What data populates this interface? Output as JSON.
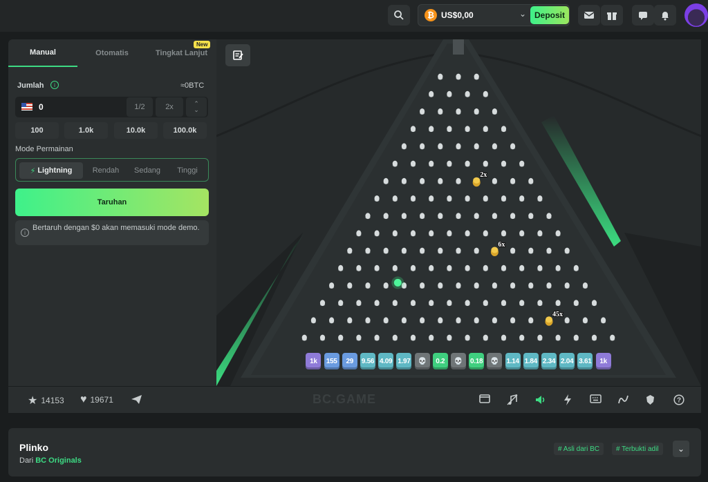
{
  "header": {
    "balance": "US$0,00",
    "deposit_label": "Deposit"
  },
  "panel": {
    "tabs": [
      "Manual",
      "Otomatis",
      "Tingkat Lanjut"
    ],
    "new_badge": "New",
    "amount_label": "Jumlah",
    "amount_btc": "≈0BTC",
    "amount_value": "0",
    "half_label": "1/2",
    "double_label": "2x",
    "chips": [
      "100",
      "1.0k",
      "10.0k",
      "100.0k"
    ],
    "mode_label": "Mode Permainan",
    "modes": [
      "Lightning",
      "Rendah",
      "Sedang",
      "Tinggi"
    ],
    "bet_label": "Taruhan",
    "demo_note": "Bertaruh dengan $0 akan memasuki mode demo."
  },
  "board": {
    "rows": 16,
    "multipliers": [
      "1k",
      "155",
      "29",
      "9.56",
      "4.09",
      "1.97",
      "💀",
      "0.2",
      "💀",
      "0.18",
      "💀",
      "1.14",
      "1.84",
      "2.34",
      "2.04",
      "3.61",
      "1k"
    ],
    "bucket_colors": [
      "#8f7bd8",
      "#6a9be0",
      "#6a9be0",
      "#5fb8c4",
      "#5fb8c4",
      "#5fb8c4",
      "#6f7577",
      "#3fcf7f",
      "#6f7577",
      "#3fcf7f",
      "#6f7577",
      "#5fb8c4",
      "#5fb8c4",
      "#5fb8c4",
      "#5fb8c4",
      "#5fb8c4",
      "#8f7bd8"
    ],
    "coin_boosts": [
      {
        "row": 6,
        "col": 5,
        "label": "2x"
      },
      {
        "row": 10,
        "col": 8,
        "label": "6x"
      },
      {
        "row": 14,
        "col": 13,
        "label": "45x"
      }
    ],
    "ball": {
      "row": 12,
      "col": 4
    }
  },
  "bottombar": {
    "favorites": "14153",
    "likes": "19671",
    "watermark": "BC.GAME"
  },
  "info": {
    "title": "Plinko",
    "from_label": "Dari",
    "provider": "BC Originals",
    "tags": [
      "# Asli dari BC",
      "# Terbukti adil"
    ]
  },
  "colors": {
    "accent": "#3ddc84",
    "background": "#1a1d1e",
    "panel": "#2a2e2f"
  }
}
